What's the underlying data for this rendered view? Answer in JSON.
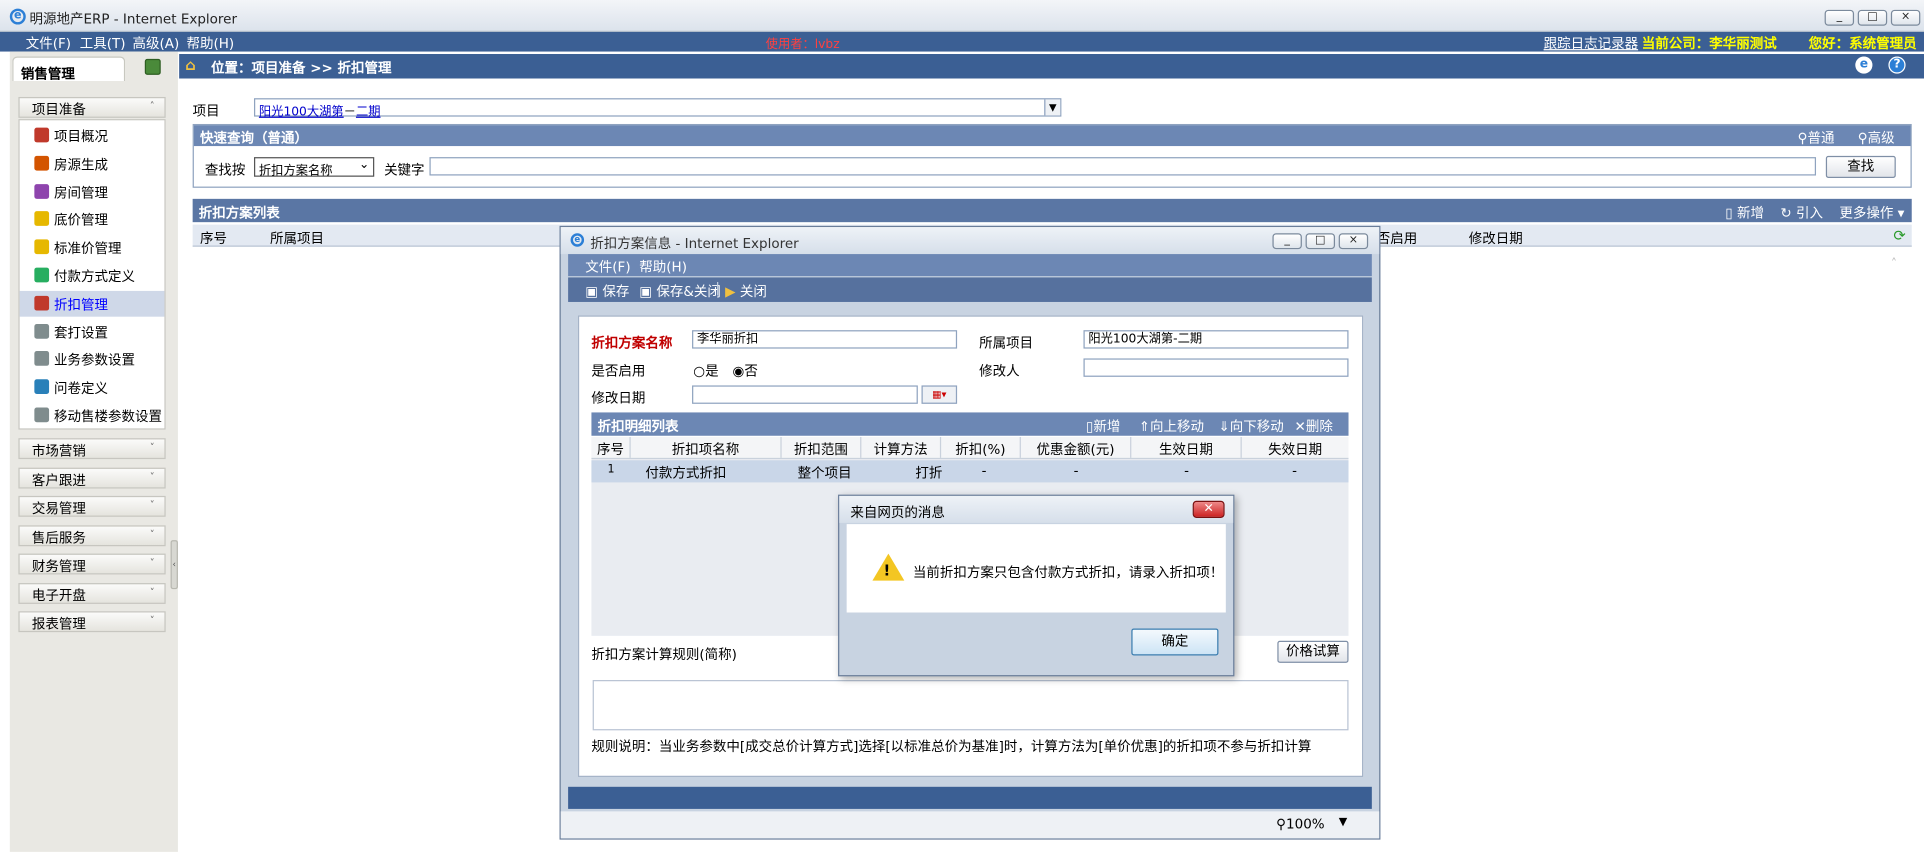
{
  "window": {
    "title": "明源地产ERP - Internet Explorer",
    "controls": [
      "_",
      "□",
      "×"
    ]
  },
  "menubar": {
    "items": [
      "文件(F)",
      "工具(T)",
      "高级(A)",
      "帮助(H)"
    ],
    "user_label": "使用者：lvbz",
    "log_link": "跟踪日志记录器",
    "company": "当前公司：李华丽测试",
    "greeting": "您好：系统管理员"
  },
  "sidebar": {
    "module_tab": "销售管理",
    "active_group": "项目准备",
    "items": [
      {
        "label": "项目概况",
        "color": "#c0392b"
      },
      {
        "label": "房源生成",
        "color": "#d35400"
      },
      {
        "label": "房间管理",
        "color": "#8e44ad"
      },
      {
        "label": "底价管理",
        "color": "#e6b800"
      },
      {
        "label": "标准价管理",
        "color": "#e6b800"
      },
      {
        "label": "付款方式定义",
        "color": "#27ae60"
      },
      {
        "label": "折扣管理",
        "color": "#c0392b"
      },
      {
        "label": "套打设置",
        "color": "#7f8c8d"
      },
      {
        "label": "业务参数设置",
        "color": "#7f8c8d"
      },
      {
        "label": "问卷定义",
        "color": "#2980b9"
      },
      {
        "label": "移动售楼参数设置",
        "color": "#7f8c8d"
      }
    ],
    "groups": [
      "市场营销",
      "客户跟进",
      "交易管理",
      "售后服务",
      "财务管理",
      "电子开盘",
      "报表管理"
    ]
  },
  "breadcrumb": {
    "text": "位置：项目准备 >> 折扣管理"
  },
  "project": {
    "label": "项目",
    "value_link1": "阳光100大湖第",
    "value_sep": "－",
    "value_link2": "二期"
  },
  "quick_search": {
    "title": "快速查询（普通）",
    "mode_normal": "普通",
    "mode_advanced": "高级",
    "find_by_label": "查找按",
    "find_by_value": "折扣方案名称",
    "keyword_label": "关键字",
    "keyword_value": "",
    "search_button": "查找"
  },
  "list": {
    "title": "折扣方案列表",
    "actions": {
      "new": "新增",
      "import": "引入",
      "more": "更多操作"
    },
    "columns": {
      "seq": "序号",
      "project": "所属项目",
      "enabled": "否启用",
      "modified": "修改日期"
    }
  },
  "dialog": {
    "title": "折扣方案信息 - Internet Explorer",
    "menu": [
      "文件(F)",
      "帮助(H)"
    ],
    "toolbar": {
      "save": "保存",
      "save_close": "保存&关闭",
      "close": "关闭"
    },
    "form": {
      "name_label": "折扣方案名称",
      "name_value": "李华丽折扣",
      "project_label": "所属项目",
      "project_value": "阳光100大湖第-二期",
      "enabled_label": "是否启用",
      "yes": "是",
      "no": "否",
      "enabled_value": "否",
      "modifier_label": "修改人",
      "modifier_value": "",
      "modified_label": "修改日期",
      "modified_value": ""
    },
    "detail": {
      "title": "折扣明细列表",
      "actions": {
        "new": "新增",
        "up": "向上移动",
        "down": "向下移动",
        "delete": "删除"
      },
      "columns": [
        "序号",
        "折扣项名称",
        "折扣范围",
        "计算方法",
        "折扣(%)",
        "优惠金额(元)",
        "生效日期",
        "失效日期"
      ],
      "rows": [
        [
          "1",
          "付款方式折扣",
          "整个项目",
          "打折",
          "-",
          "-",
          "-",
          "-"
        ]
      ]
    },
    "rule_label": "折扣方案计算规则(简称)",
    "trial_button": "价格试算",
    "rule_text": "",
    "note": "规则说明：当业务参数中[成交总价计算方式]选择[以标准总价为基准]时，计算方法为[单价优惠]的折扣项不参与折扣计算",
    "zoom": "100%"
  },
  "alert": {
    "title": "来自网页的消息",
    "message": "当前折扣方案只包含付款方式折扣，请录入折扣项！",
    "ok": "确定"
  },
  "colors": {
    "header_blue": "#3b5f94",
    "section_blue": "#6c87b4",
    "highlight_yellow": "#ffff00",
    "label_red": "#c00000"
  }
}
